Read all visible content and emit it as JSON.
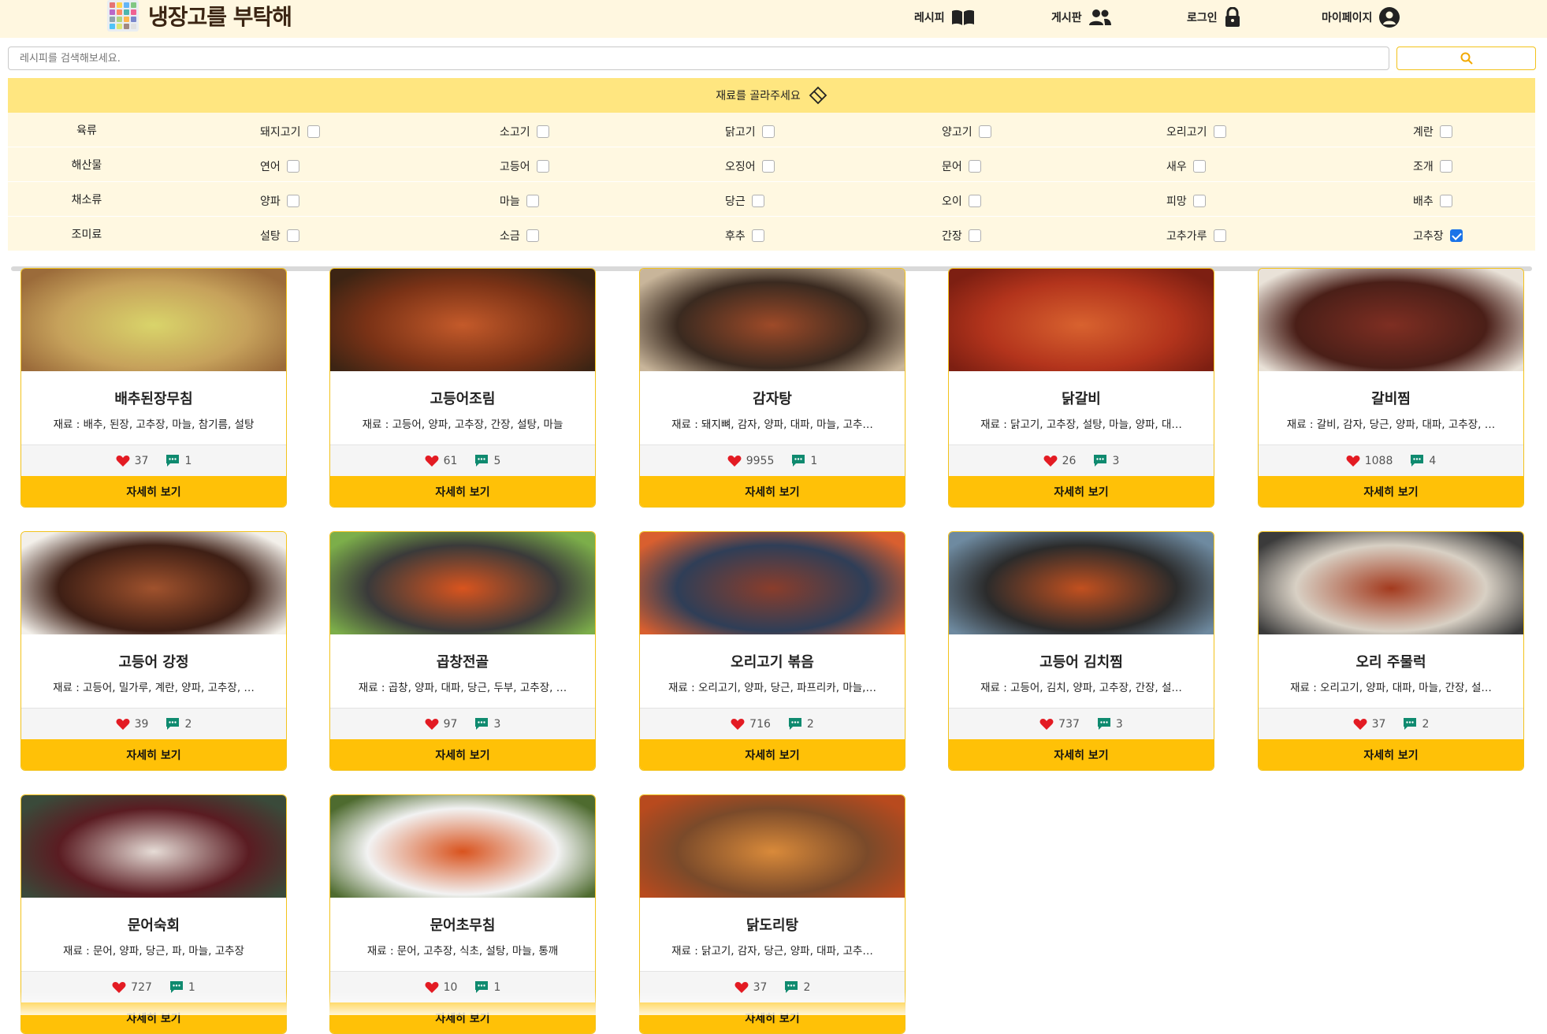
{
  "header": {
    "logo_text": "냉장고를 부탁해",
    "nav": [
      {
        "label": "레시피",
        "icon": "book-icon"
      },
      {
        "label": "게시판",
        "icon": "users-icon"
      },
      {
        "label": "로그인",
        "icon": "lock-icon"
      },
      {
        "label": "마이페이지",
        "icon": "user-circle-icon"
      }
    ]
  },
  "search": {
    "placeholder": "레시피를 검색해보세요.",
    "button_icon": "search-icon"
  },
  "filter": {
    "header": "재료를 골라주세요",
    "header_icon": "eraser-icon",
    "rows": [
      {
        "category": "육류",
        "options": [
          {
            "label": "돼지고기",
            "checked": false
          },
          {
            "label": "소고기",
            "checked": false
          },
          {
            "label": "닭고기",
            "checked": false
          },
          {
            "label": "양고기",
            "checked": false
          },
          {
            "label": "오리고기",
            "checked": false
          },
          {
            "label": "계란",
            "checked": false
          }
        ]
      },
      {
        "category": "해산물",
        "options": [
          {
            "label": "연어",
            "checked": false
          },
          {
            "label": "고등어",
            "checked": false
          },
          {
            "label": "오징어",
            "checked": false
          },
          {
            "label": "문어",
            "checked": false
          },
          {
            "label": "새우",
            "checked": false
          },
          {
            "label": "조개",
            "checked": false
          }
        ]
      },
      {
        "category": "채소류",
        "options": [
          {
            "label": "양파",
            "checked": false
          },
          {
            "label": "마늘",
            "checked": false
          },
          {
            "label": "당근",
            "checked": false
          },
          {
            "label": "오이",
            "checked": false
          },
          {
            "label": "피망",
            "checked": false
          },
          {
            "label": "배추",
            "checked": false
          }
        ]
      },
      {
        "category": "조미료",
        "options": [
          {
            "label": "설탕",
            "checked": false
          },
          {
            "label": "소금",
            "checked": false
          },
          {
            "label": "후추",
            "checked": false
          },
          {
            "label": "간장",
            "checked": false
          },
          {
            "label": "고추가루",
            "checked": false
          },
          {
            "label": "고추장",
            "checked": true
          }
        ]
      }
    ]
  },
  "recipes": [
    {
      "title": "배추된장무침",
      "ingredients": "재료 : 배추, 된장, 고추장, 마늘, 참기름, 설탕",
      "likes": "37",
      "comments": "1",
      "button": "자세히 보기"
    },
    {
      "title": "고등어조림",
      "ingredients": "재료 : 고등어, 양파, 고추장, 간장, 설탕, 마늘",
      "likes": "61",
      "comments": "5",
      "button": "자세히 보기"
    },
    {
      "title": "감자탕",
      "ingredients": "재료 : 돼지뼈, 감자, 양파, 대파, 마늘, 고추…",
      "likes": "9955",
      "comments": "1",
      "button": "자세히 보기"
    },
    {
      "title": "닭갈비",
      "ingredients": "재료 : 닭고기, 고추장, 설탕, 마늘, 양파, 대…",
      "likes": "26",
      "comments": "3",
      "button": "자세히 보기"
    },
    {
      "title": "갈비찜",
      "ingredients": "재료 : 갈비, 감자, 당근, 양파, 대파, 고추장, …",
      "likes": "1088",
      "comments": "4",
      "button": "자세히 보기"
    },
    {
      "title": "고등어 강정",
      "ingredients": "재료 : 고등어, 밀가루, 계란, 양파, 고추장, …",
      "likes": "39",
      "comments": "2",
      "button": "자세히 보기"
    },
    {
      "title": "곱창전골",
      "ingredients": "재료 : 곱창, 양파, 대파, 당근, 두부, 고추장, …",
      "likes": "97",
      "comments": "3",
      "button": "자세히 보기"
    },
    {
      "title": "오리고기 볶음",
      "ingredients": "재료 : 오리고기, 양파, 당근, 파프리카, 마늘,…",
      "likes": "716",
      "comments": "2",
      "button": "자세히 보기"
    },
    {
      "title": "고등어 김치찜",
      "ingredients": "재료 : 고등어, 김치, 양파, 고추장, 간장, 설…",
      "likes": "737",
      "comments": "3",
      "button": "자세히 보기"
    },
    {
      "title": "오리 주물럭",
      "ingredients": "재료 : 오리고기, 양파, 대파, 마늘, 간장, 설…",
      "likes": "37",
      "comments": "2",
      "button": "자세히 보기"
    },
    {
      "title": "문어숙회",
      "ingredients": "재료 : 문어, 양파, 당근, 파, 마늘, 고추장",
      "likes": "727",
      "comments": "1",
      "button": "자세히 보기"
    },
    {
      "title": "문어초무침",
      "ingredients": "재료 : 문어, 고추장, 식초, 설탕, 마늘, 통깨",
      "likes": "10",
      "comments": "1",
      "button": "자세히 보기"
    },
    {
      "title": "닭도리탕",
      "ingredients": "재료 : 닭고기, 감자, 당근, 양파, 대파, 고추…",
      "likes": "37",
      "comments": "2",
      "button": "자세히 보기"
    }
  ],
  "colors": {
    "accent": "#ffc107",
    "header_bg": "#fff7e0",
    "filter_head": "#ffe680",
    "filter_row": "#fff8e1",
    "heart": "#e31b23",
    "comment": "#0f8a6f"
  }
}
